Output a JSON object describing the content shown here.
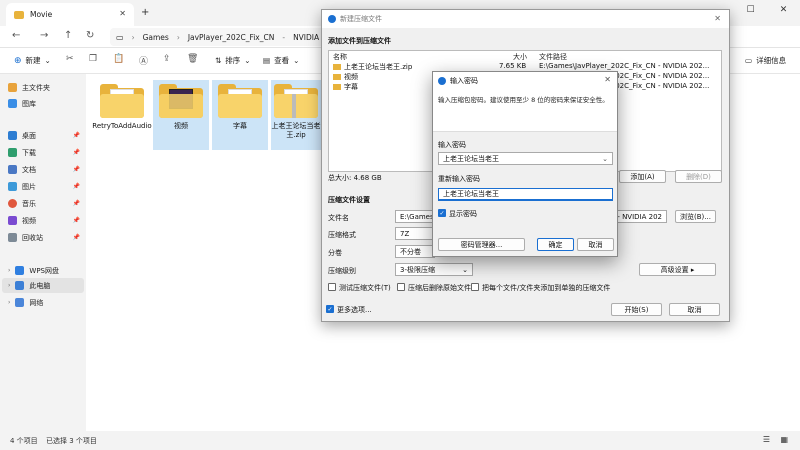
{
  "explorer": {
    "tab_title": "Movie",
    "breadcrumb": [
      "Games",
      "JavPlayer_202C_Fix_CN",
      "NVIDIA 202"
    ],
    "toolbar": {
      "new": "新建",
      "sort": "排序",
      "view": "查看",
      "details": "详细信息"
    },
    "sidebar": [
      {
        "label": "主文件夹",
        "icon": "home-icon",
        "color": "#e8a33c"
      },
      {
        "label": "图库",
        "icon": "gallery-icon",
        "color": "#3a8ee6"
      },
      {
        "label": "桌面",
        "icon": "desktop-icon",
        "color": "#2d7dd2",
        "pinned": true
      },
      {
        "label": "下载",
        "icon": "download-icon",
        "color": "#2f9e6e",
        "pinned": true
      },
      {
        "label": "文档",
        "icon": "document-icon",
        "color": "#4a78c4",
        "pinned": true
      },
      {
        "label": "图片",
        "icon": "pictures-icon",
        "color": "#3d9ad9",
        "pinned": true
      },
      {
        "label": "音乐",
        "icon": "music-icon",
        "color": "#e0573d",
        "pinned": true
      },
      {
        "label": "视频",
        "icon": "video-icon",
        "color": "#7a4bd1",
        "pinned": true
      },
      {
        "label": "回收站",
        "icon": "recycle-bin-icon",
        "color": "#7d8a96",
        "pinned": true
      },
      {
        "label": "WPS网盘",
        "icon": "cloud-drive-icon",
        "color": "#2f7fe0"
      },
      {
        "label": "此电脑",
        "icon": "this-pc-icon",
        "color": "#3b7fd6"
      },
      {
        "label": "网络",
        "icon": "network-icon",
        "color": "#4b86d9"
      }
    ],
    "files": [
      {
        "name": "RetryToAddAudio",
        "type": "folder"
      },
      {
        "name": "视频",
        "type": "folder"
      },
      {
        "name": "字幕",
        "type": "folder"
      },
      {
        "name": "上老王论坛当老王.zip",
        "type": "zip"
      }
    ],
    "status": {
      "count": "4 个项目",
      "selected": "已选择 3 个项目"
    }
  },
  "archive_dialog": {
    "title": "新建压缩文件",
    "add_files_title": "添加文件到压缩文件",
    "columns": [
      "名称",
      "大小",
      "文件路径"
    ],
    "rows": [
      {
        "name": "上老王论坛当老王.zip",
        "size": "7.65 KB",
        "path": "E:\\Games\\JavPlayer_202C_Fix_CN - NVIDIA 202..."
      },
      {
        "name": "视频",
        "size": "",
        "path": "E:\\Games\\JavPlayer_202C_Fix_CN - NVIDIA 202..."
      },
      {
        "name": "字幕",
        "size": "",
        "path": "E:\\Games\\JavPlayer_202C_Fix_CN - NVIDIA 202..."
      }
    ],
    "total_size": "总大小: 4.68 GB",
    "add_button": "添加(A)",
    "delete_button": "删除(D)",
    "settings_title": "压缩文件设置",
    "file_name_label": "文件名",
    "file_name_value": "E:\\Games\\Jav",
    "file_name_tail": "CN - NVIDIA 202",
    "browse_button": "浏览(B)...",
    "format_label": "压缩格式",
    "format_value": "7Z",
    "split_label": "分卷",
    "split_value": "不分卷",
    "level_label": "压缩级别",
    "level_value": "3-极限压缩",
    "advanced_button": "高级设置 ▸",
    "options": [
      {
        "label": "测试压缩文件(T)",
        "checked": false
      },
      {
        "label": "压缩后删除原始文件",
        "checked": false
      },
      {
        "label": "把每个文件/文件夹添加到单独的压缩文件",
        "checked": false
      }
    ],
    "more_options": "更多选项...",
    "start_button": "开始(S)",
    "cancel_button": "取消"
  },
  "password_dialog": {
    "title": "输入密码",
    "description": "输入压缩包密码。建议使用至少 8 位的密码来保证安全性。",
    "enter_label": "输入密码",
    "enter_value": "上老王论坛当老王",
    "reenter_label": "重新输入密码",
    "reenter_value": "上老王论坛当老王",
    "show_password": "显示密码",
    "manager_button": "密码管理器...",
    "ok_button": "确定",
    "cancel_button": "取消"
  }
}
